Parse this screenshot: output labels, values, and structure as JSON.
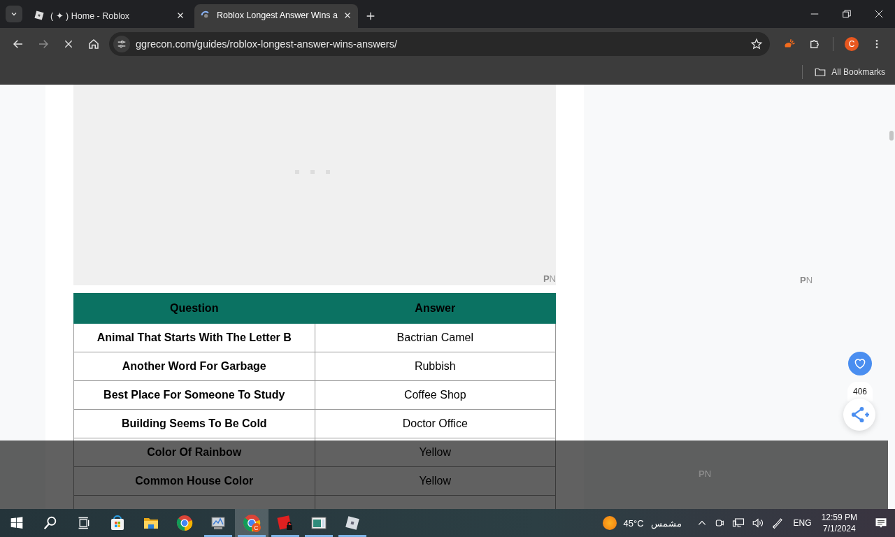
{
  "browser": {
    "tabs": [
      {
        "title": "( ✦ ) Home - Roblox",
        "selected": false
      },
      {
        "title": "Roblox Longest Answer Wins a",
        "selected": true
      }
    ],
    "url": "ggrecon.com/guides/roblox-longest-answer-wins-answers/",
    "profile_initial": "C",
    "bookmarks_label": "All Bookmarks"
  },
  "page": {
    "ad_label": "**P**N",
    "side_ad_label": "**P**N",
    "table": {
      "columns": [
        "Question",
        "Answer"
      ],
      "rows": [
        {
          "question": "Animal That Starts With The Letter B",
          "answer": "Bactrian Camel"
        },
        {
          "question": "Another Word For Garbage",
          "answer": "Rubbish"
        },
        {
          "question": "Best Place For Someone To Study",
          "answer": "Coffee Shop"
        },
        {
          "question": "Building Seems To Be Cold",
          "answer": "Doctor Office"
        },
        {
          "question": "Color Of Rainbow",
          "answer": "Yellow"
        },
        {
          "question": "Common House Color",
          "answer": "Yellow"
        }
      ]
    },
    "likes": "406",
    "bottom_ad_label": "**P**N"
  },
  "taskbar": {
    "apps": [
      {
        "kind": "store",
        "running": false,
        "selected": false
      },
      {
        "kind": "files",
        "running": false,
        "selected": false
      },
      {
        "kind": "chrome",
        "running": false,
        "selected": false
      },
      {
        "kind": "monitor",
        "running": true,
        "selected": false
      },
      {
        "kind": "chrome-profile",
        "running": true,
        "selected": true,
        "badge": "C"
      },
      {
        "kind": "game-editor",
        "running": true,
        "selected": false
      },
      {
        "kind": "window",
        "running": true,
        "selected": false
      },
      {
        "kind": "game",
        "running": true,
        "selected": false
      }
    ],
    "weather": {
      "temp": "45°C",
      "condition": "مشمس"
    },
    "language": "ENG",
    "time": "12:59 PM",
    "date": "7/1/2024"
  }
}
